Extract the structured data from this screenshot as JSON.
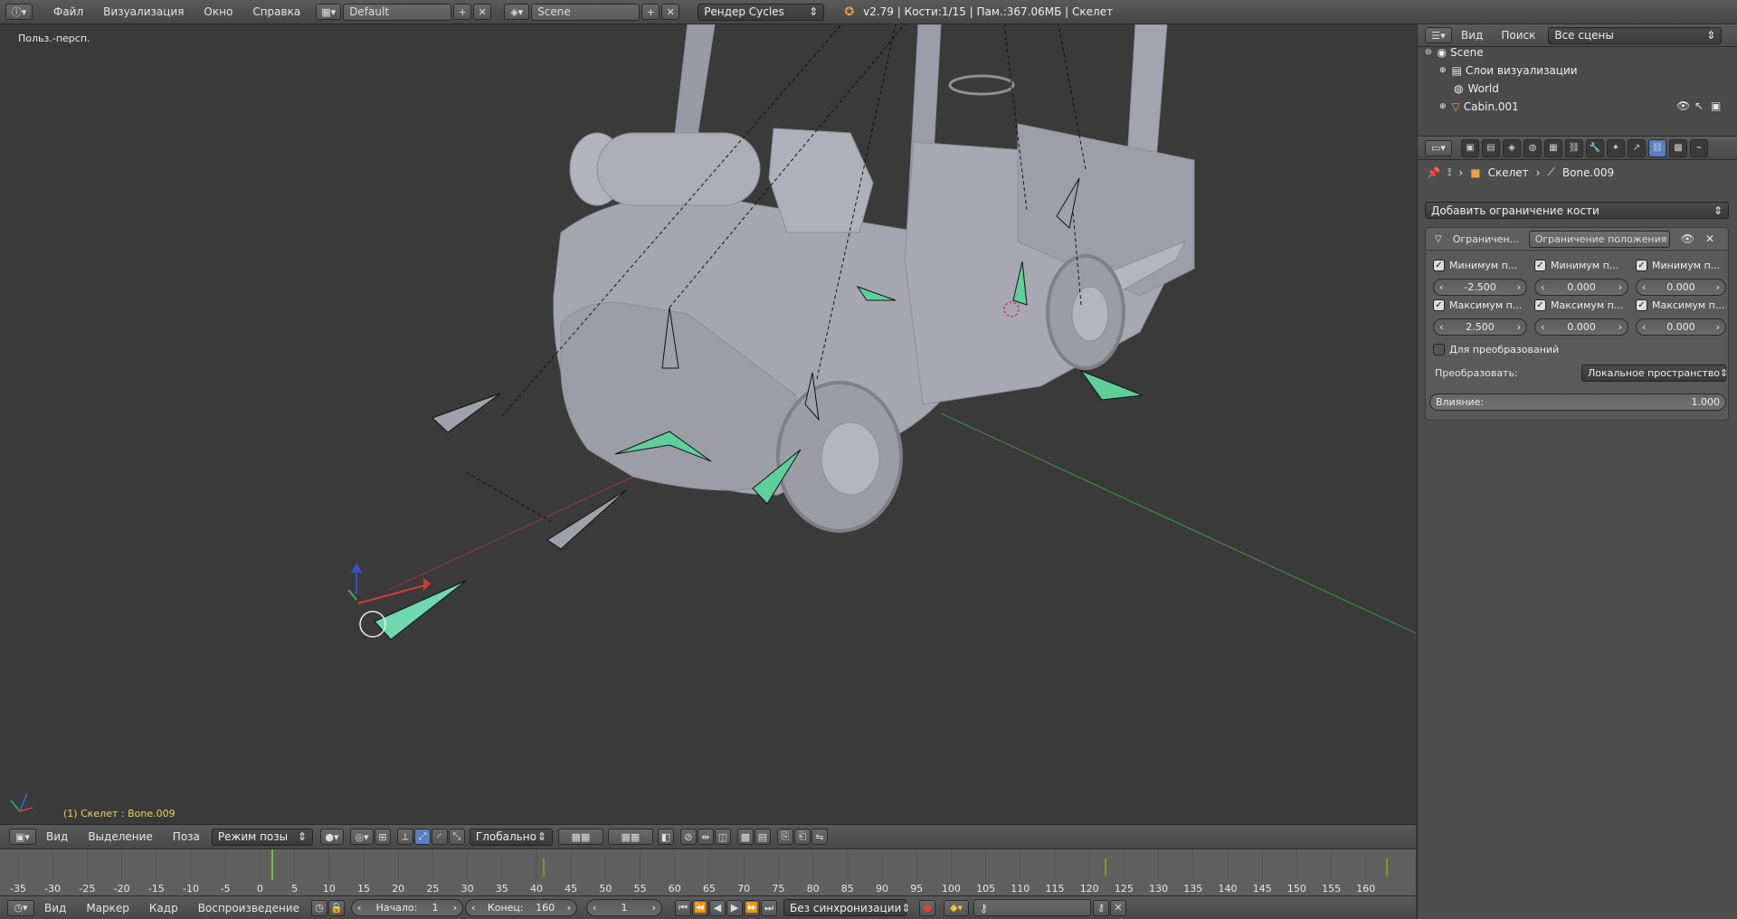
{
  "topbar": {
    "menus": [
      "Файл",
      "Визуализация",
      "Окно",
      "Справка"
    ],
    "layout": "Default",
    "scene": "Scene",
    "engine": "Рендер Cycles",
    "info": "v2.79 | Кости:1/15 | Пам.:367.06МБ | Скелет"
  },
  "viewport": {
    "view_label": "Польз.-персп.",
    "status": "(1) Скелет : Bone.009"
  },
  "outliner": {
    "header": {
      "view": "Вид",
      "search": "Поиск",
      "scenes": "Все сцены"
    },
    "rows": [
      {
        "label": "Scene"
      },
      {
        "label": "Слои визуализации"
      },
      {
        "label": "World"
      },
      {
        "label": "Cabin.001"
      }
    ]
  },
  "properties": {
    "breadcrumb": {
      "object": "Скелет",
      "bone": "Bone.009"
    },
    "add_constraint": "Добавить ограничение кости",
    "constraint": {
      "short_name": "Ограничен...",
      "name": "Ограничение положения",
      "min_labels": [
        "Минимум п...",
        "Минимум п...",
        "Минимум п..."
      ],
      "min_values": [
        "-2.500",
        "0.000",
        "0.000"
      ],
      "max_labels": [
        "Максимум п...",
        "Максимум п...",
        "Максимум п..."
      ],
      "max_values": [
        "2.500",
        "0.000",
        "0.000"
      ],
      "for_transform": "Для преобразований",
      "convert_label": "Преобразовать:",
      "convert_value": "Локальное пространство",
      "influence_label": "Влияние:",
      "influence_value": "1.000"
    }
  },
  "vp_header": {
    "menus": [
      "Вид",
      "Выделение",
      "Поза"
    ],
    "mode": "Режим позы",
    "orientation": "Глобально"
  },
  "timeline": {
    "ticks": [
      "-35",
      "-30",
      "-25",
      "-20",
      "-15",
      "-10",
      "-5",
      "0",
      "5",
      "10",
      "15",
      "20",
      "25",
      "30",
      "35",
      "40",
      "45",
      "50",
      "55",
      "60",
      "65",
      "70",
      "75",
      "80",
      "85",
      "90",
      "95",
      "100",
      "105",
      "110",
      "115",
      "120",
      "125",
      "130",
      "135",
      "140",
      "145",
      "150",
      "155",
      "160"
    ],
    "current_frame": 1
  },
  "tl_header": {
    "menus": [
      "Вид",
      "Маркер",
      "Кадр",
      "Воспроизведение"
    ],
    "start_label": "Начало:",
    "start_value": "1",
    "end_label": "Конец:",
    "end_value": "160",
    "current": "1",
    "sync": "Без синхронизации"
  },
  "colors": {
    "accent": "#5680c2",
    "bone_selected": "#5fcf9a",
    "frame_marker": "#6fc23a"
  }
}
